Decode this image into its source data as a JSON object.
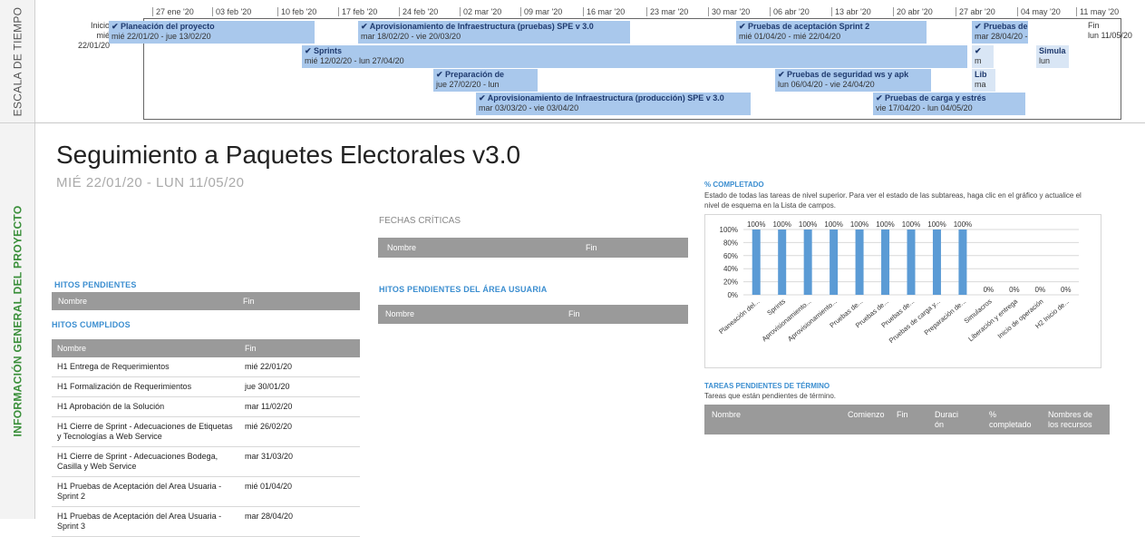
{
  "sidebar": {
    "timeline_label": "ESCALA DE TIEMPO",
    "overview_label": "INFORMACIÓN GENERAL DEL PROYECTO"
  },
  "timeline": {
    "ticks": [
      "27 ene '20",
      "03 feb '20",
      "10 feb '20",
      "17 feb '20",
      "24 feb '20",
      "02 mar '20",
      "09 mar '20",
      "16 mar '20",
      "23 mar '20",
      "30 mar '20",
      "06 abr '20",
      "13 abr '20",
      "20 abr '20",
      "27 abr '20",
      "04 may '20",
      "11 may '20"
    ],
    "start_label": "Inicio",
    "start_date": "mié 22/01/20",
    "end_label": "Fin",
    "end_date": "lun 11/05/20",
    "bars": [
      {
        "name": "✔ Planeación del proyecto",
        "dates": "mié 22/01/20 - jue 13/02/20"
      },
      {
        "name": "✔ Aprovisionamiento de Infraestructura (pruebas) SPE v 3.0",
        "dates": "mar 18/02/20 - vie 20/03/20"
      },
      {
        "name": "✔ Pruebas de aceptación Sprint 2",
        "dates": "mié 01/04/20 - mié 22/04/20"
      },
      {
        "name": "✔ Pruebas de",
        "dates": "mar 28/04/20 -"
      },
      {
        "name": "✔ Sprints",
        "dates": "mié 12/02/20 - lun 27/04/20"
      },
      {
        "name": "✔",
        "dates": "m"
      },
      {
        "name": "Simula",
        "dates": "lun"
      },
      {
        "name": "✔ Preparación de",
        "dates": "jue 27/02/20 - lun"
      },
      {
        "name": "✔ Pruebas de seguridad ws y apk",
        "dates": "lun 06/04/20 - vie 24/04/20"
      },
      {
        "name": "Lib",
        "dates": "ma"
      },
      {
        "name": "✔ Aprovisionamiento de Infraestructura (producción) SPE v 3.0",
        "dates": "mar 03/03/20 - vie 03/04/20"
      },
      {
        "name": "✔ Pruebas de carga y estrés",
        "dates": "vie 17/04/20 - lun 04/05/20"
      }
    ]
  },
  "main": {
    "title": "Seguimiento a Paquetes Electorales v3.0",
    "daterange": "MIÉ 22/01/20 -  LUN 11/05/20"
  },
  "fechas_criticas": {
    "title": "FECHAS CRÍTICAS",
    "col_name": "Nombre",
    "col_end": "Fin"
  },
  "hitos_pendientes": {
    "title": "HITOS PENDIENTES",
    "col_name": "Nombre",
    "col_end": "Fin"
  },
  "hitos_area": {
    "title": "HITOS PENDIENTES DEL ÁREA USUARIA",
    "col_name": "Nombre",
    "col_end": "Fin"
  },
  "hitos_cumplidos": {
    "title": "HITOS CUMPLIDOS",
    "col_name": "Nombre",
    "col_end": "Fin",
    "rows": [
      {
        "name": "H1 Entrega de Requerimientos",
        "end": "mié 22/01/20"
      },
      {
        "name": "H1 Formalización de Requerimientos",
        "end": "jue 30/01/20"
      },
      {
        "name": "H1 Aprobación de la Solución",
        "end": "mar 11/02/20"
      },
      {
        "name": "H1 Cierre de Sprint - Adecuaciones de Etiquetas y Tecnologías a Web Service",
        "end": "mié 26/02/20"
      },
      {
        "name": "H1 Cierre de Sprint - Adecuaciones Bodega, Casilla y Web Service",
        "end": "mar 31/03/20"
      },
      {
        "name": "H1 Pruebas de Aceptación del Area Usuaria - Sprint 2",
        "end": "mié 01/04/20"
      },
      {
        "name": "H1 Pruebas de Aceptación del Area Usuaria - Sprint 3",
        "end": "mar 28/04/20"
      }
    ]
  },
  "completado": {
    "title": "% COMPLETADO",
    "desc": "Estado de todas las tareas de nivel superior. Para ver el estado de las subtareas, haga clic en el gráfico y actualice el nivel de esquema en la Lista de campos."
  },
  "chart_data": {
    "type": "bar",
    "categories": [
      "Planeación del...",
      "Sprints",
      "Aprovisionamiento...",
      "Aprovisionamiento...",
      "Pruebas de...",
      "Pruebas de...",
      "Pruebas de...",
      "Pruebas de carga y...",
      "Preparación de...",
      "Simulacros",
      "Liberación y entrega",
      "Inicio de operación",
      "H2 Inicio de..."
    ],
    "values": [
      100,
      100,
      100,
      100,
      100,
      100,
      100,
      100,
      100,
      0,
      0,
      0,
      0
    ],
    "value_labels": [
      "100%",
      "100%",
      "100%",
      "100%",
      "100%",
      "100%",
      "100%",
      "100%",
      "100%",
      "0%",
      "0%",
      "0%",
      "0%"
    ],
    "yticks": [
      "100%",
      "80%",
      "60%",
      "40%",
      "20%",
      "0%"
    ],
    "ylim": [
      0,
      100
    ],
    "bar_color": "#5b9bd5"
  },
  "tareas": {
    "title": "TAREAS PENDIENTES DE TÉRMINO",
    "desc": "Tareas que están pendientes de término.",
    "cols": [
      "Nombre",
      "Comienzo",
      "Fin",
      "Duraci ón",
      "% completado",
      "Nombres de los recursos"
    ]
  }
}
